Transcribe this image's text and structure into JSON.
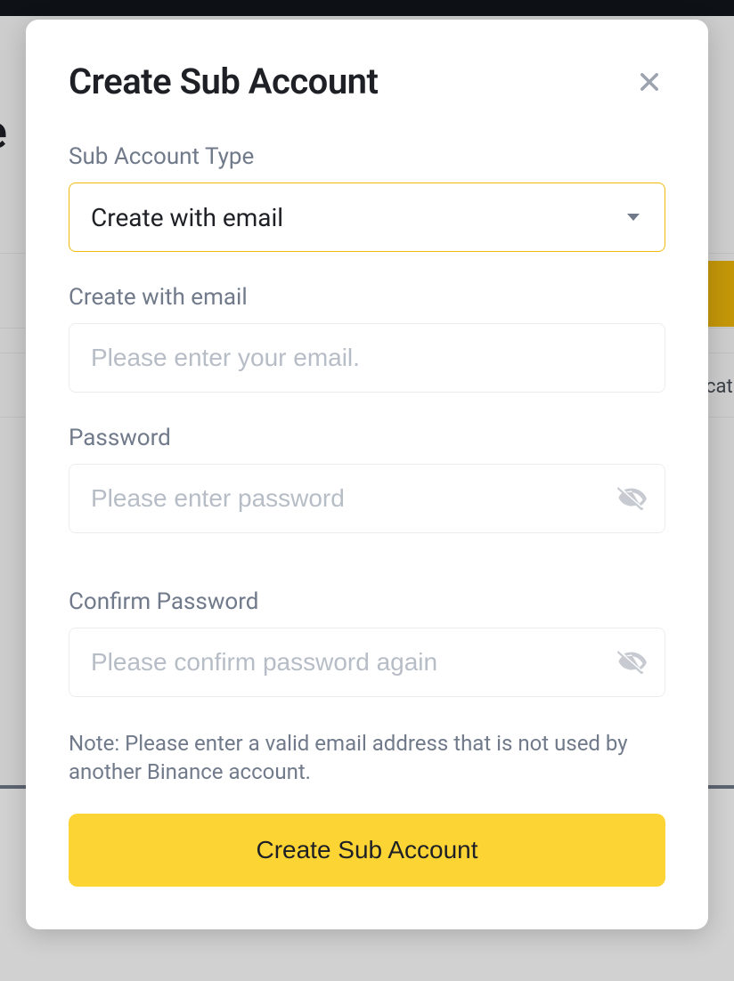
{
  "background": {
    "heading_fragment": "e",
    "text_fragment": "cati"
  },
  "modal": {
    "title": "Create Sub Account",
    "type_field": {
      "label": "Sub Account Type",
      "selected": "Create with email"
    },
    "email_field": {
      "label": "Create with email",
      "placeholder": "Please enter your email.",
      "value": ""
    },
    "password_field": {
      "label": "Password",
      "placeholder": "Please enter password",
      "value": ""
    },
    "confirm_password_field": {
      "label": "Confirm Password",
      "placeholder": "Please confirm password again",
      "value": ""
    },
    "note": "Note: Please enter a valid email address that is not used by another Binance account.",
    "submit_label": "Create Sub Account"
  }
}
